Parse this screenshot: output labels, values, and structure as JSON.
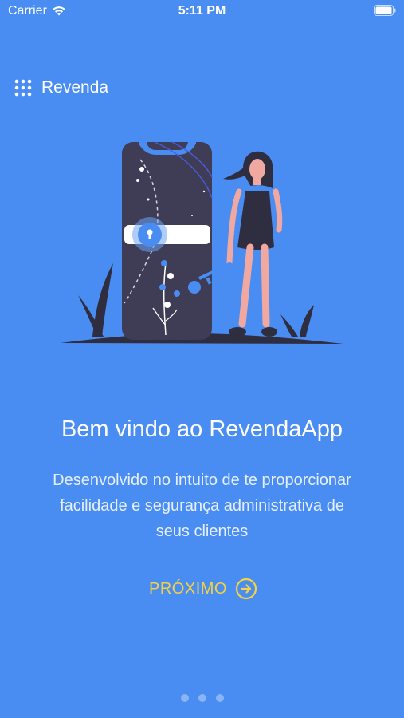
{
  "status_bar": {
    "carrier": "Carrier",
    "time": "5:11 PM",
    "wifi_icon": "wifi-icon",
    "battery_icon": "battery-icon"
  },
  "brand": {
    "icon": "grid-dots-icon",
    "title": "Revenda"
  },
  "onboarding": {
    "illustration": "phone-lock-key-illustration",
    "title": "Bem vindo ao RevendaApp",
    "description": "Desenvolvido no intuito de te proporcionar facilidade e segurança administrativa de seus clientes",
    "next_label": "PRÓXIMO",
    "next_icon": "arrow-right-circle-icon"
  },
  "pagination": {
    "total_pages": 3,
    "current_page": 1
  },
  "colors": {
    "background": "#4a8df2",
    "accent": "#f4d33f",
    "text": "#ffffff"
  }
}
